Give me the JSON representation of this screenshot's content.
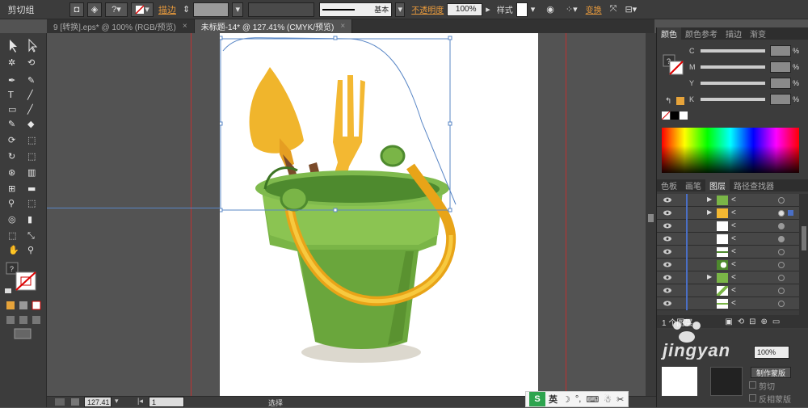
{
  "control": {
    "group_label": "剪切组",
    "stroke_label": "描边",
    "stroke_style": "基本",
    "opacity_label": "不透明度",
    "opacity_value": "100%",
    "style_label": "样式",
    "transform_label": "变换"
  },
  "tabs": [
    {
      "label": "9 [转换].eps* @ 100% (RGB/预览)",
      "active": false
    },
    {
      "label": "未标题-14* @ 127.41% (CMYK/预览)",
      "active": true
    }
  ],
  "panel": {
    "tabs1": [
      "颜色",
      "颜色参考",
      "描边",
      "渐变"
    ],
    "channels": [
      "C",
      "M",
      "Y",
      "K"
    ],
    "channel_values": [
      "%",
      "%",
      "%",
      "%"
    ],
    "tabs2": [
      "色板",
      "画笔",
      "图层",
      "路径查找器"
    ],
    "layer_count": "1 个图层",
    "opacity_value": "100%",
    "mask_label": "制作蒙版",
    "clip_label": "剪切",
    "invert_label": "反相蒙版"
  },
  "status": {
    "zoom": "127.41",
    "page": "1",
    "mode": "选择"
  },
  "ime": {
    "lang": "英"
  },
  "watermark": "jingyan"
}
